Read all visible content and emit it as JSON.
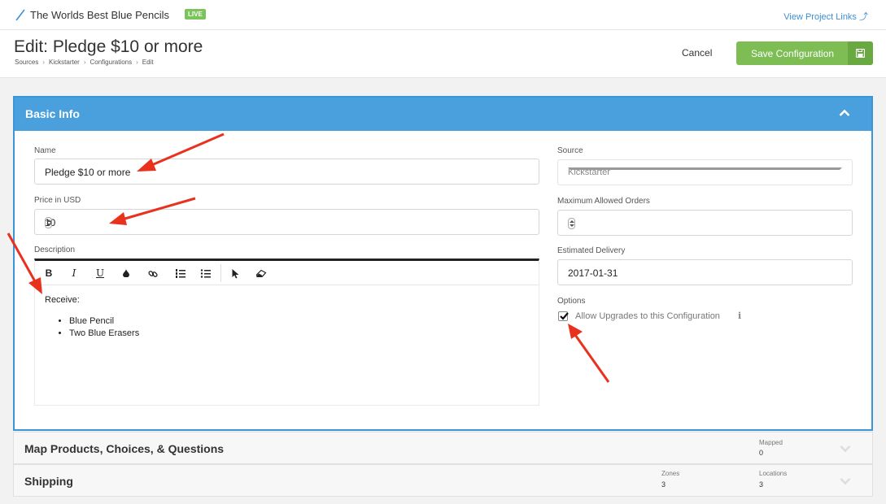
{
  "topbar": {
    "project_title": "The Worlds Best Blue Pencils",
    "live_badge": "LIVE",
    "project_links": "View Project Links ⤴"
  },
  "header": {
    "title": "Edit: Pledge $10 or more",
    "breadcrumb": [
      "Sources",
      "Kickstarter",
      "Configurations",
      "Edit"
    ],
    "cancel_label": "Cancel",
    "save_label": "Save Configuration"
  },
  "basic_info": {
    "title": "Basic Info",
    "name_label": "Name",
    "name_value": "Pledge $10 or more",
    "price_label": "Price in USD",
    "price_value": "10",
    "description_label": "Description",
    "description": {
      "intro": "Receive:",
      "items": [
        "Blue Pencil",
        "Two Blue Erasers"
      ]
    },
    "source_label": "Source",
    "source_value": "Kickstarter",
    "max_orders_label": "Maximum Allowed Orders",
    "max_orders_value": "",
    "delivery_label": "Estimated Delivery",
    "delivery_value": "2017-01-31",
    "options_label": "Options",
    "allow_upgrades_label": "Allow Upgrades to this Configuration",
    "allow_upgrades_checked": true
  },
  "toolbar_icons": [
    "bold-icon",
    "italic-icon",
    "underline-icon",
    "color-drop-icon",
    "link-icon",
    "ordered-list-icon",
    "bullet-list-icon",
    "cursor-icon",
    "eraser-icon"
  ],
  "toolbar_glyphs": {
    "bold": "B",
    "italic": "I",
    "underline": "U"
  },
  "map_section": {
    "title": "Map Products, Choices, & Questions",
    "mapped_label": "Mapped",
    "mapped_value": "0"
  },
  "shipping_section": {
    "title": "Shipping",
    "zones_label": "Zones",
    "zones_value": "3",
    "locations_label": "Locations",
    "locations_value": "3"
  },
  "colors": {
    "accent": "#4a9fdd",
    "save": "#7dbd53",
    "live": "#7ac45a",
    "annotation_arrow": "#e8321e"
  }
}
